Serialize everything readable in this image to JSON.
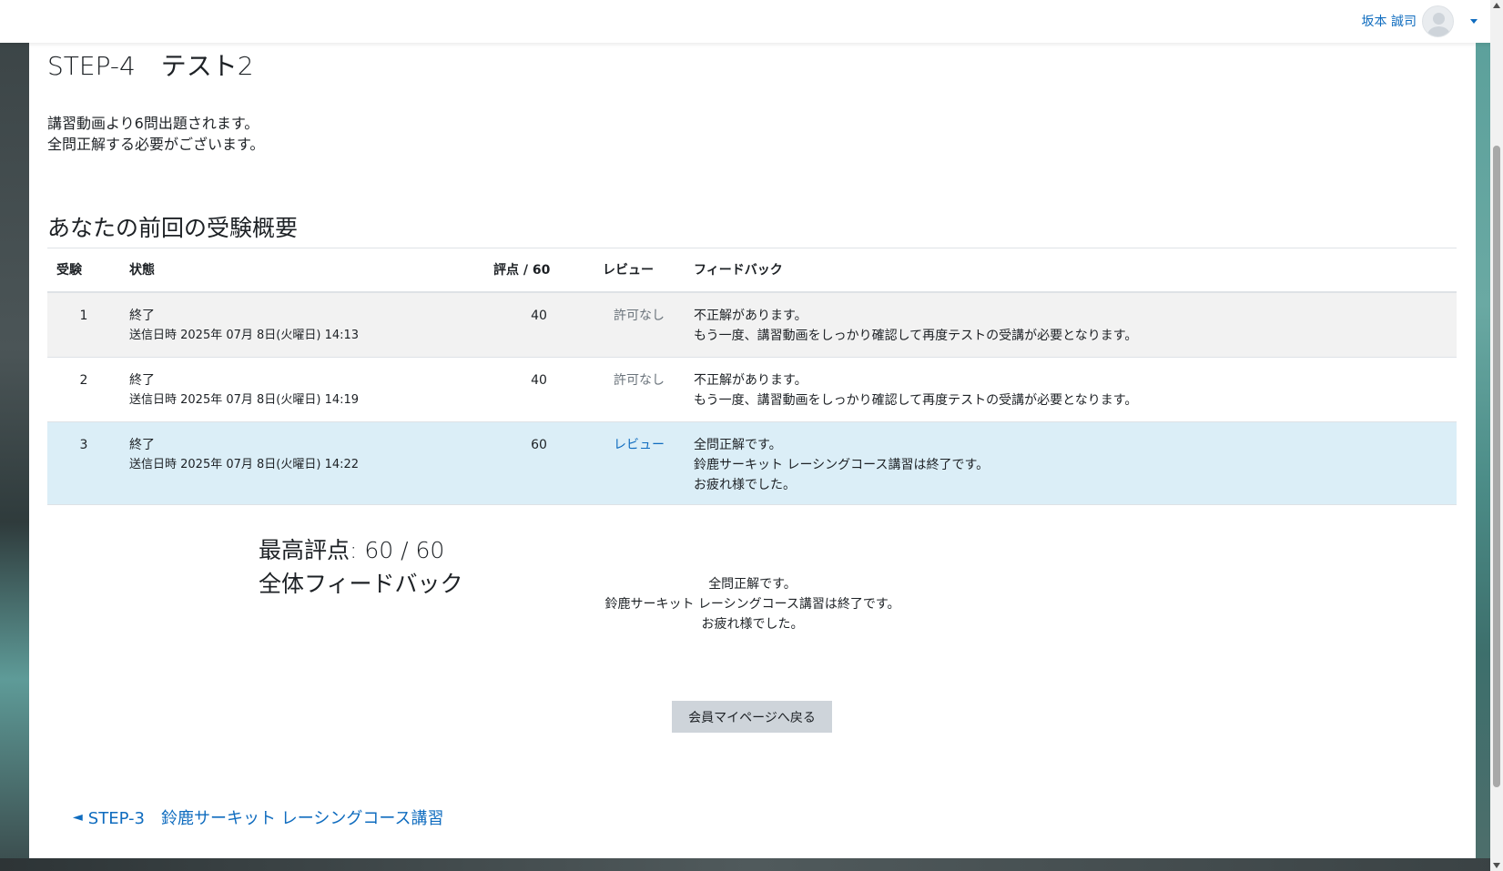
{
  "user": {
    "name": "坂本 誠司"
  },
  "page": {
    "title": "STEP-4　テスト2",
    "intro_line1": "講習動画より6問出題されます。",
    "intro_line2": "全問正解する必要がございます。",
    "summary_title": "あなたの前回の受験概要"
  },
  "table": {
    "headers": {
      "attempt": "受験",
      "state": "状態",
      "grade": "評点 / 60",
      "review": "レビュー",
      "feedback": "フィードバック"
    },
    "rows": [
      {
        "attempt": "1",
        "state": "終了",
        "submitted": "送信日時 2025年 07月 8日(火曜日) 14:13",
        "grade": "40",
        "review": "許可なし",
        "fb1": "不正解があります。",
        "fb2": "もう一度、講習動画をしっかり確認して再度テストの受講が必要となります。"
      },
      {
        "attempt": "2",
        "state": "終了",
        "submitted": "送信日時 2025年 07月 8日(火曜日) 14:19",
        "grade": "40",
        "review": "許可なし",
        "fb1": "不正解があります。",
        "fb2": "もう一度、講習動画をしっかり確認して再度テストの受講が必要となります。"
      },
      {
        "attempt": "3",
        "state": "終了",
        "submitted": "送信日時 2025年 07月 8日(火曜日) 14:22",
        "grade": "60",
        "review": "レビュー",
        "fb1": "全問正解です。",
        "fb2": "鈴鹿サーキット レーシングコース講習は終了です。",
        "fb3": "お疲れ様でした。"
      }
    ]
  },
  "result": {
    "best_grade": "最高評点: 60 / 60",
    "overall_title": "全体フィードバック",
    "fb1": "全問正解です。",
    "fb2": "鈴鹿サーキット レーシングコース講習は終了です。",
    "fb3": "お疲れ様でした。",
    "back_button": "会員マイページへ戻る"
  },
  "nav": {
    "prev_arrow": "◄",
    "prev_label": "STEP-3　鈴鹿サーキット レーシングコース講習"
  },
  "colors": {
    "link": "#0f6cbf",
    "highlight_row": "#dbeef7",
    "button_bg": "#ced4da"
  }
}
